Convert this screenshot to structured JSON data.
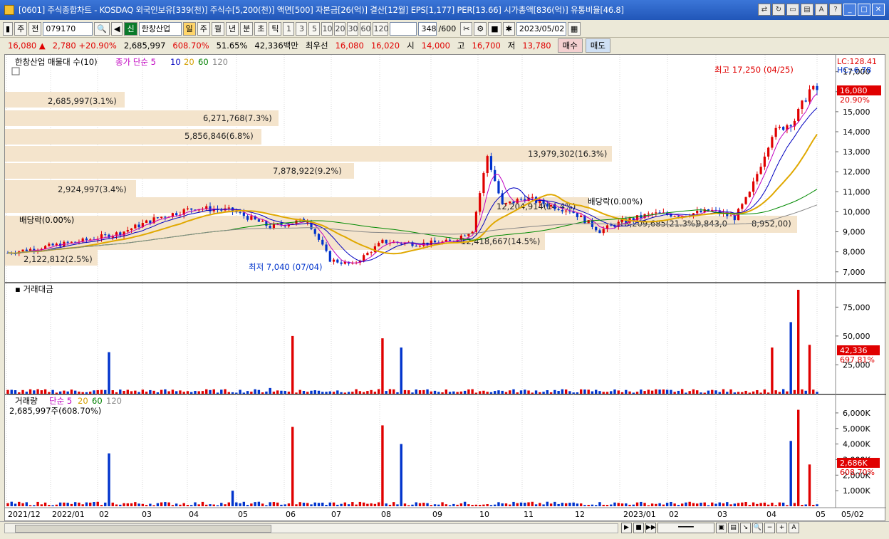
{
  "window": {
    "title": "[0601] 주식종합차트 - KOSDAQ 외국인보유[339(천)] 주식수[5,200(천)] 액면[500] 자본금[26(억)] 결산[12월] EPS[1,177] PER[13.66] 시가총액[836(억)] 유통비율[46.8]"
  },
  "toolbar": {
    "mode1": "주",
    "mode2": "전",
    "code": "079170",
    "badge": "신",
    "name": "한창산업",
    "periods": [
      "일",
      "주",
      "월",
      "년",
      "분",
      "초",
      "틱"
    ],
    "nums": [
      "1",
      "3",
      "5",
      "10",
      "20",
      "30",
      "60",
      "120"
    ],
    "count": "348",
    "countmax": "/600",
    "date": "2023/05/02"
  },
  "price": {
    "close": "16,080",
    "arrow": "▲",
    "change": "2,780",
    "pct": "+20.90%",
    "volume": "2,685,997",
    "vol_pct": "608.70%",
    "ratio": "51.65%",
    "amount": "42,336백만",
    "best_label": "최우선",
    "best_ask": "16,080",
    "best_bid": "16,020",
    "open_label": "시",
    "open": "14,000",
    "high_label": "고",
    "high": "16,700",
    "low_label": "저",
    "low": "13,780",
    "buy": "매수",
    "sell": "매도"
  },
  "panel1": {
    "legend_title": "한창산업 매물대 수(10)",
    "legend_ma": "종가 단순 5",
    "ma_periods": [
      "10",
      "20",
      "60",
      "120"
    ],
    "lc": "LC:128.41",
    "hc": "HC:-6.78",
    "last_price": "16,080",
    "last_pct": "20.90%",
    "max_label": "최고 17,250 (04/25)",
    "min_label": "최저 7,040 (07/04)",
    "div_labels": [
      "배당락(0.00%)",
      "배당락(0.00%)"
    ]
  },
  "volume_profile": [
    {
      "label": "2,685,997(3.1%)"
    },
    {
      "label": "6,271,768(7.3%)"
    },
    {
      "label": "5,856,846(6.8%)"
    },
    {
      "label": "13,979,302(16.3%)"
    },
    {
      "label": "7,878,922(9.2%)"
    },
    {
      "label": "2,924,997(3.4%)"
    },
    {
      "label": "12,204,914(14.4%)"
    },
    {
      "label": "18,209,685(21.3%)"
    },
    {
      "label": "9,843,0"
    },
    {
      "label": "8,952,00)"
    },
    {
      "label": "12,418,667(14.5%)"
    },
    {
      "label": "2,122,812(2.5%)"
    }
  ],
  "panel2": {
    "title": "거래대금",
    "last": "42,336",
    "last_pct": "697.81%"
  },
  "panel3": {
    "title": "거래량",
    "ma": "단순 5",
    "ma_periods": [
      "20",
      "60",
      "120"
    ],
    "info": "2,685,997주(608.70%)",
    "last": "2,686K",
    "last_pct": "608.70%"
  },
  "chart_data": [
    {
      "type": "candlestick",
      "title": "한창산업",
      "y_ticks": [
        "17,000",
        "16,000",
        "15,000",
        "14,000",
        "13,000",
        "12,000",
        "11,000",
        "10,000",
        "9,000",
        "8,000",
        "7,000"
      ],
      "ylim": [
        6600,
        17700
      ],
      "x_labels": [
        "2021/12",
        "2022/01",
        "02",
        "03",
        "04",
        "05",
        "06",
        "07",
        "08",
        "09",
        "10",
        "11",
        "12",
        "2023/01",
        "02",
        "03",
        "04",
        "05",
        "05/02"
      ],
      "close_path": [
        [
          0,
          7950
        ],
        [
          10,
          8250
        ],
        [
          20,
          8550
        ],
        [
          30,
          8950
        ],
        [
          40,
          9700
        ],
        [
          50,
          10200
        ],
        [
          60,
          10050
        ],
        [
          70,
          9250
        ],
        [
          80,
          9600
        ],
        [
          86,
          7600
        ],
        [
          92,
          7350
        ],
        [
          100,
          8500
        ],
        [
          110,
          8400
        ],
        [
          118,
          8500
        ],
        [
          124,
          9100
        ],
        [
          128,
          12800
        ],
        [
          132,
          10300
        ],
        [
          138,
          10700
        ],
        [
          146,
          10250
        ],
        [
          150,
          10100
        ],
        [
          158,
          9050
        ],
        [
          164,
          9500
        ],
        [
          172,
          9900
        ],
        [
          180,
          9850
        ],
        [
          188,
          10050
        ],
        [
          194,
          9700
        ],
        [
          198,
          10900
        ],
        [
          204,
          13900
        ],
        [
          210,
          14600
        ],
        [
          214,
          16080
        ]
      ]
    },
    {
      "type": "bar",
      "title": "거래대금",
      "y_ticks": [
        "75,000",
        "50,000",
        "25,000"
      ],
      "ylim": [
        0,
        90000
      ],
      "spikes": [
        [
          27,
          36000
        ],
        [
          70,
          5000
        ],
        [
          76,
          50000
        ],
        [
          100,
          48000
        ],
        [
          105,
          40000
        ],
        [
          204,
          40000
        ],
        [
          209,
          62000
        ],
        [
          211,
          90000
        ],
        [
          214,
          42336
        ]
      ]
    },
    {
      "type": "bar",
      "title": "거래량",
      "y_ticks": [
        "6,000K",
        "5,000K",
        "4,000K",
        "3,000K",
        "2,000K",
        "1,000K"
      ],
      "ylim": [
        0,
        6500
      ],
      "spikes": [
        [
          27,
          3400
        ],
        [
          60,
          1000
        ],
        [
          76,
          5100
        ],
        [
          100,
          5200
        ],
        [
          105,
          4000
        ],
        [
          209,
          4200
        ],
        [
          211,
          6200
        ],
        [
          214,
          2686
        ]
      ]
    }
  ]
}
